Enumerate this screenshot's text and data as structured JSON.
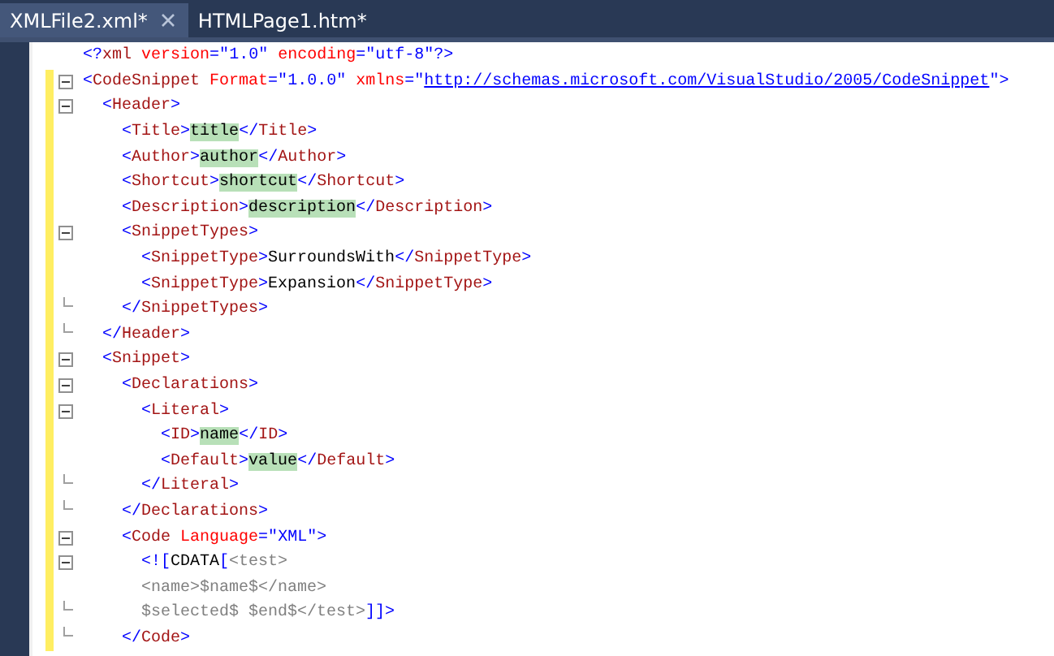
{
  "tabs": [
    {
      "label": "XMLFile2.xml*",
      "selected": true,
      "closable": true
    },
    {
      "label": "HTMLPage1.htm*",
      "selected": false,
      "closable": false
    }
  ],
  "lines": [
    {
      "changed": false,
      "collapsible": false,
      "block_end": false,
      "tokens": [
        {
          "t": "<?",
          "kind": "punct"
        },
        {
          "t": "xml ",
          "kind": "tag"
        },
        {
          "t": "version",
          "kind": "attr"
        },
        {
          "t": "=\"",
          "kind": "punct"
        },
        {
          "t": "1.0",
          "kind": "value"
        },
        {
          "t": "\" ",
          "kind": "punct"
        },
        {
          "t": "encoding",
          "kind": "attr"
        },
        {
          "t": "=\"",
          "kind": "punct"
        },
        {
          "t": "utf-8",
          "kind": "value"
        },
        {
          "t": "\"?>",
          "kind": "punct"
        }
      ]
    },
    {
      "changed": true,
      "collapsible": true,
      "block_end": false,
      "tokens": [
        {
          "t": "<",
          "kind": "punct"
        },
        {
          "t": "CodeSnippet ",
          "kind": "tag"
        },
        {
          "t": "Format",
          "kind": "attr"
        },
        {
          "t": "=\"",
          "kind": "punct"
        },
        {
          "t": "1.0.0",
          "kind": "value"
        },
        {
          "t": "\" ",
          "kind": "punct"
        },
        {
          "t": "xmlns",
          "kind": "attr"
        },
        {
          "t": "=\"",
          "kind": "punct"
        },
        {
          "t": "http://schemas.microsoft.com/VisualStudio/2005/CodeSnippet",
          "kind": "link"
        },
        {
          "t": "\">",
          "kind": "punct"
        }
      ]
    },
    {
      "changed": true,
      "collapsible": true,
      "block_end": false,
      "tokens": [
        {
          "t": "  <",
          "kind": "punct"
        },
        {
          "t": "Header",
          "kind": "tag"
        },
        {
          "t": ">",
          "kind": "punct"
        }
      ]
    },
    {
      "changed": true,
      "collapsible": false,
      "block_end": false,
      "tokens": [
        {
          "t": "    <",
          "kind": "punct"
        },
        {
          "t": "Title",
          "kind": "tag"
        },
        {
          "t": ">",
          "kind": "punct"
        },
        {
          "t": "title",
          "kind": "highlight"
        },
        {
          "t": "</",
          "kind": "punct"
        },
        {
          "t": "Title",
          "kind": "tag"
        },
        {
          "t": ">",
          "kind": "punct"
        }
      ]
    },
    {
      "changed": true,
      "collapsible": false,
      "block_end": false,
      "tokens": [
        {
          "t": "    <",
          "kind": "punct"
        },
        {
          "t": "Author",
          "kind": "tag"
        },
        {
          "t": ">",
          "kind": "punct"
        },
        {
          "t": "author",
          "kind": "highlight"
        },
        {
          "t": "</",
          "kind": "punct"
        },
        {
          "t": "Author",
          "kind": "tag"
        },
        {
          "t": ">",
          "kind": "punct"
        }
      ]
    },
    {
      "changed": true,
      "collapsible": false,
      "block_end": false,
      "tokens": [
        {
          "t": "    <",
          "kind": "punct"
        },
        {
          "t": "Shortcut",
          "kind": "tag"
        },
        {
          "t": ">",
          "kind": "punct"
        },
        {
          "t": "shortcut",
          "kind": "highlight"
        },
        {
          "t": "</",
          "kind": "punct"
        },
        {
          "t": "Shortcut",
          "kind": "tag"
        },
        {
          "t": ">",
          "kind": "punct"
        }
      ]
    },
    {
      "changed": true,
      "collapsible": false,
      "block_end": false,
      "tokens": [
        {
          "t": "    <",
          "kind": "punct"
        },
        {
          "t": "Description",
          "kind": "tag"
        },
        {
          "t": ">",
          "kind": "punct"
        },
        {
          "t": "description",
          "kind": "highlight"
        },
        {
          "t": "</",
          "kind": "punct"
        },
        {
          "t": "Description",
          "kind": "tag"
        },
        {
          "t": ">",
          "kind": "punct"
        }
      ]
    },
    {
      "changed": true,
      "collapsible": true,
      "block_end": false,
      "tokens": [
        {
          "t": "    <",
          "kind": "punct"
        },
        {
          "t": "SnippetTypes",
          "kind": "tag"
        },
        {
          "t": ">",
          "kind": "punct"
        }
      ]
    },
    {
      "changed": true,
      "collapsible": false,
      "block_end": false,
      "tokens": [
        {
          "t": "      <",
          "kind": "punct"
        },
        {
          "t": "SnippetType",
          "kind": "tag"
        },
        {
          "t": ">",
          "kind": "punct"
        },
        {
          "t": "SurroundsWith",
          "kind": "text"
        },
        {
          "t": "</",
          "kind": "punct"
        },
        {
          "t": "SnippetType",
          "kind": "tag"
        },
        {
          "t": ">",
          "kind": "punct"
        }
      ]
    },
    {
      "changed": true,
      "collapsible": false,
      "block_end": false,
      "tokens": [
        {
          "t": "      <",
          "kind": "punct"
        },
        {
          "t": "SnippetType",
          "kind": "tag"
        },
        {
          "t": ">",
          "kind": "punct"
        },
        {
          "t": "Expansion",
          "kind": "text"
        },
        {
          "t": "</",
          "kind": "punct"
        },
        {
          "t": "SnippetType",
          "kind": "tag"
        },
        {
          "t": ">",
          "kind": "punct"
        }
      ]
    },
    {
      "changed": true,
      "collapsible": false,
      "block_end": true,
      "tokens": [
        {
          "t": "    </",
          "kind": "punct"
        },
        {
          "t": "SnippetTypes",
          "kind": "tag"
        },
        {
          "t": ">",
          "kind": "punct"
        }
      ]
    },
    {
      "changed": true,
      "collapsible": false,
      "block_end": true,
      "tokens": [
        {
          "t": "  </",
          "kind": "punct"
        },
        {
          "t": "Header",
          "kind": "tag"
        },
        {
          "t": ">",
          "kind": "punct"
        }
      ]
    },
    {
      "changed": true,
      "collapsible": true,
      "block_end": false,
      "tokens": [
        {
          "t": "  <",
          "kind": "punct"
        },
        {
          "t": "Snippet",
          "kind": "tag"
        },
        {
          "t": ">",
          "kind": "punct"
        }
      ]
    },
    {
      "changed": true,
      "collapsible": true,
      "block_end": false,
      "tokens": [
        {
          "t": "    <",
          "kind": "punct"
        },
        {
          "t": "Declarations",
          "kind": "tag"
        },
        {
          "t": ">",
          "kind": "punct"
        }
      ]
    },
    {
      "changed": true,
      "collapsible": true,
      "block_end": false,
      "tokens": [
        {
          "t": "      <",
          "kind": "punct"
        },
        {
          "t": "Literal",
          "kind": "tag"
        },
        {
          "t": ">",
          "kind": "punct"
        }
      ]
    },
    {
      "changed": true,
      "collapsible": false,
      "block_end": false,
      "tokens": [
        {
          "t": "        <",
          "kind": "punct"
        },
        {
          "t": "ID",
          "kind": "tag"
        },
        {
          "t": ">",
          "kind": "punct"
        },
        {
          "t": "name",
          "kind": "highlight"
        },
        {
          "t": "</",
          "kind": "punct"
        },
        {
          "t": "ID",
          "kind": "tag"
        },
        {
          "t": ">",
          "kind": "punct"
        }
      ]
    },
    {
      "changed": true,
      "collapsible": false,
      "block_end": false,
      "tokens": [
        {
          "t": "        <",
          "kind": "punct"
        },
        {
          "t": "Default",
          "kind": "tag"
        },
        {
          "t": ">",
          "kind": "punct"
        },
        {
          "t": "value",
          "kind": "highlight"
        },
        {
          "t": "</",
          "kind": "punct"
        },
        {
          "t": "Default",
          "kind": "tag"
        },
        {
          "t": ">",
          "kind": "punct"
        }
      ]
    },
    {
      "changed": true,
      "collapsible": false,
      "block_end": true,
      "tokens": [
        {
          "t": "      </",
          "kind": "punct"
        },
        {
          "t": "Literal",
          "kind": "tag"
        },
        {
          "t": ">",
          "kind": "punct"
        }
      ]
    },
    {
      "changed": true,
      "collapsible": false,
      "block_end": true,
      "tokens": [
        {
          "t": "    </",
          "kind": "punct"
        },
        {
          "t": "Declarations",
          "kind": "tag"
        },
        {
          "t": ">",
          "kind": "punct"
        }
      ]
    },
    {
      "changed": true,
      "collapsible": true,
      "block_end": false,
      "tokens": [
        {
          "t": "    <",
          "kind": "punct"
        },
        {
          "t": "Code ",
          "kind": "tag"
        },
        {
          "t": "Language",
          "kind": "attr"
        },
        {
          "t": "=\"",
          "kind": "punct"
        },
        {
          "t": "XML",
          "kind": "value"
        },
        {
          "t": "\">",
          "kind": "punct"
        }
      ]
    },
    {
      "changed": true,
      "collapsible": true,
      "block_end": false,
      "tokens": [
        {
          "t": "      <![",
          "kind": "punct"
        },
        {
          "t": "CDATA",
          "kind": "text"
        },
        {
          "t": "[",
          "kind": "punct"
        },
        {
          "t": "<test>",
          "kind": "cdata"
        }
      ]
    },
    {
      "changed": true,
      "collapsible": false,
      "block_end": false,
      "tokens": [
        {
          "t": "      <name>$name$</name>",
          "kind": "cdata"
        }
      ]
    },
    {
      "changed": true,
      "collapsible": false,
      "block_end": true,
      "tokens": [
        {
          "t": "      $selected$ $end$</test>",
          "kind": "cdata"
        },
        {
          "t": "]]>",
          "kind": "punct"
        }
      ]
    },
    {
      "changed": true,
      "collapsible": false,
      "block_end": true,
      "tokens": [
        {
          "t": "    </",
          "kind": "punct"
        },
        {
          "t": "Code",
          "kind": "tag"
        },
        {
          "t": ">",
          "kind": "punct"
        }
      ]
    }
  ]
}
